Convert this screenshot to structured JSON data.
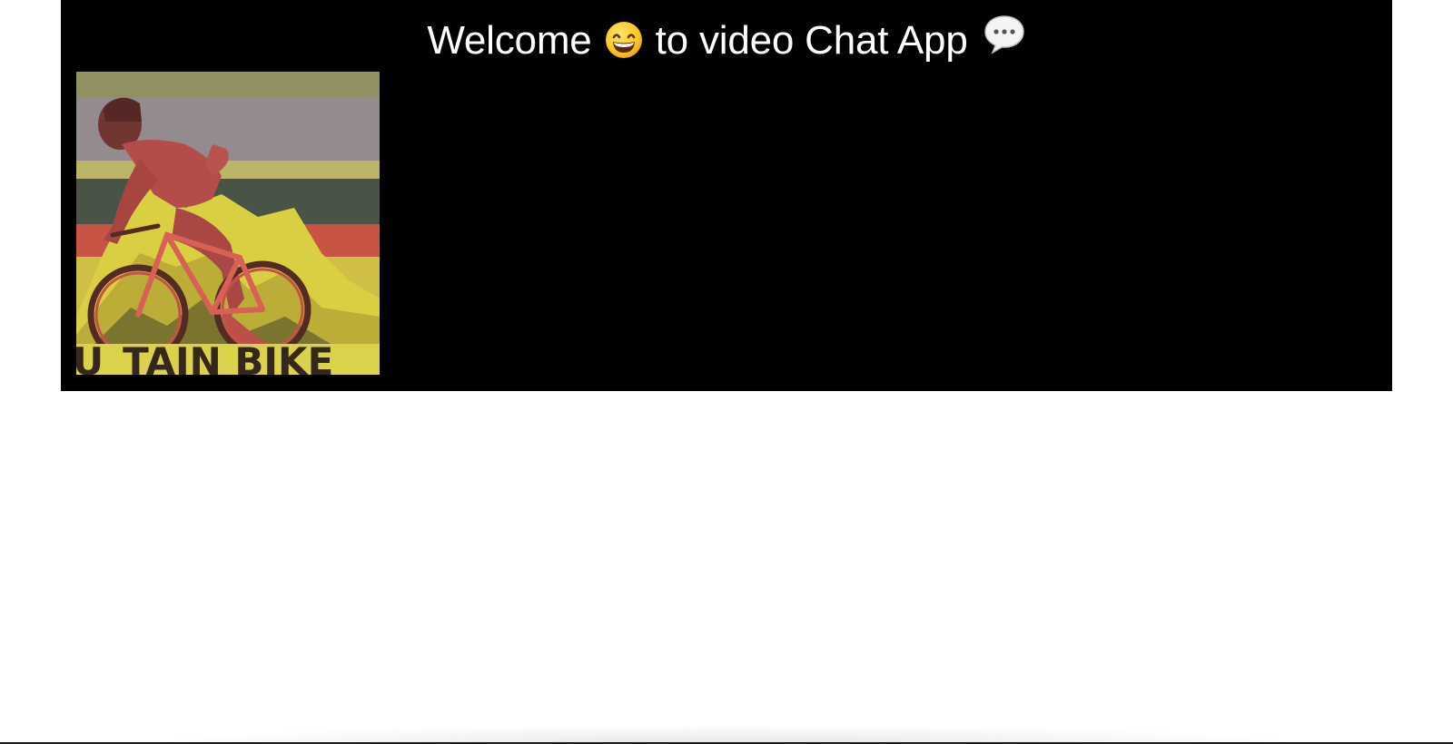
{
  "header": {
    "title_part1": "Welcome",
    "title_part2": "to video Chat App",
    "emoji_after_welcome": "grinning-face-icon",
    "emoji_after_title": "speech-balloon-icon"
  },
  "colors": {
    "panel_background": "#000000",
    "title_text": "#ffffff",
    "page_background": "#ffffff"
  },
  "video": {
    "local_stream": "local-video-feed"
  }
}
